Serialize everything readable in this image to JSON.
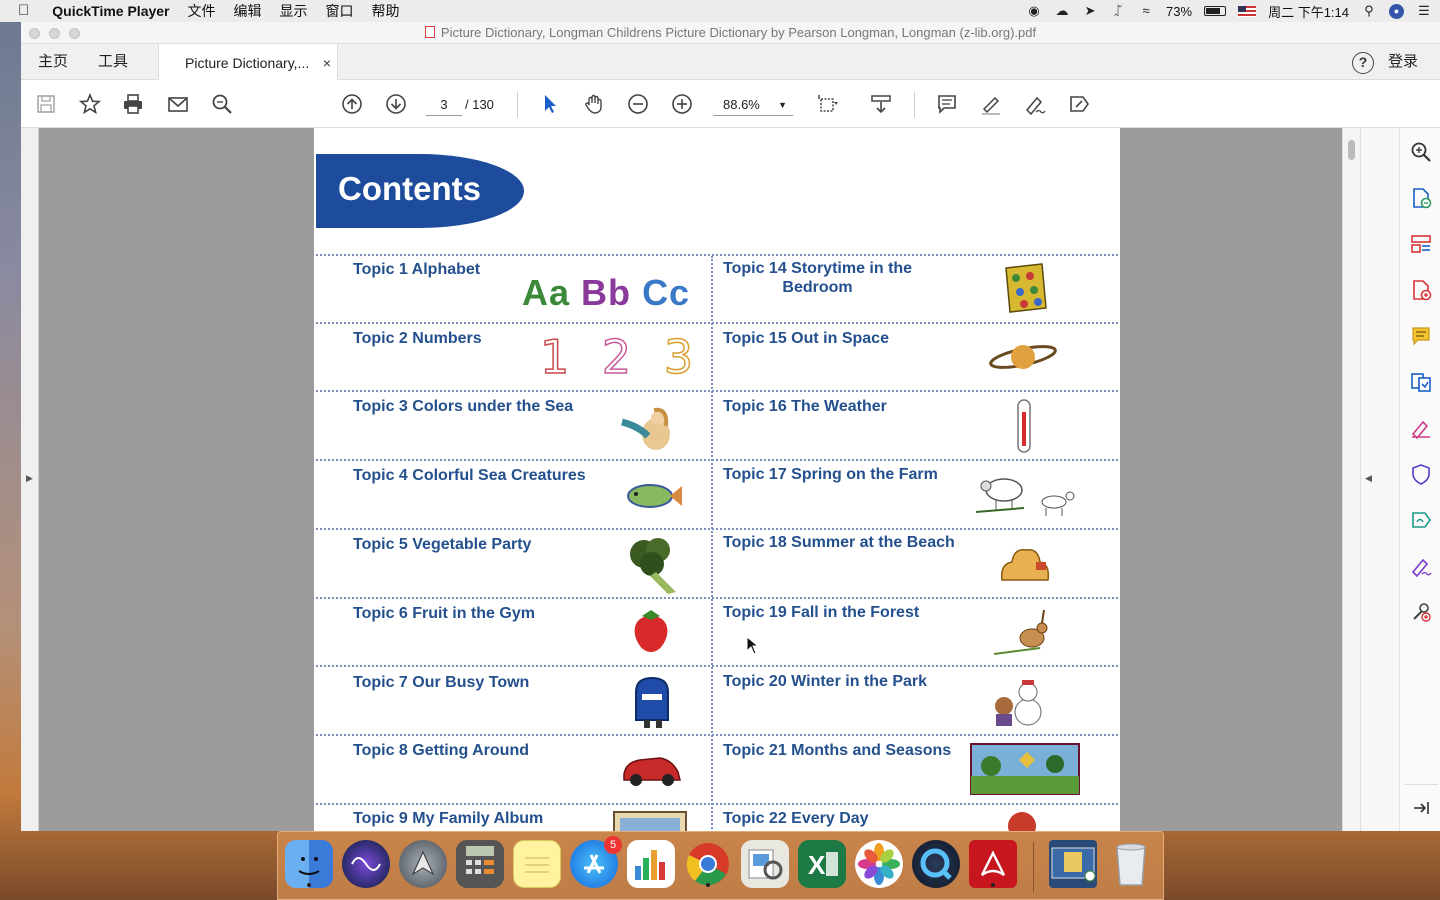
{
  "menubar": {
    "app_name": "QuickTime Player",
    "menus": [
      "文件",
      "编辑",
      "显示",
      "窗口",
      "帮助"
    ],
    "battery": "73%",
    "datetime": "周二 下午1:14"
  },
  "window": {
    "title": "Picture Dictionary, Longman Childrens Picture Dictionary by Pearson Longman, Longman (z-lib.org).pdf",
    "tabs": {
      "home": "主页",
      "tools": "工具",
      "doc": "Picture Dictionary,...",
      "close": "×"
    },
    "help": "?",
    "login": "登录"
  },
  "toolbar": {
    "page_current": "3",
    "page_total": "/ 130",
    "zoom": "88.6%"
  },
  "page": {
    "banner": "Contents",
    "left_topics": [
      "Topic 1 Alphabet",
      "Topic 2 Numbers",
      "Topic 3 Colors under the Sea",
      "Topic 4 Colorful Sea Creatures",
      "Topic 5 Vegetable Party",
      "Topic 6 Fruit in the Gym",
      "Topic 7 Our Busy Town",
      "Topic 8 Getting Around",
      "Topic 9 My Family Album"
    ],
    "right_topics": [
      "Topic 14 Storytime in the",
      "Topic 15 Out in Space",
      "Topic 16 The Weather",
      "Topic 17 Spring on the Farm",
      "Topic 18 Summer at the Beach",
      "Topic 19 Fall in the Forest",
      "Topic 20 Winter in the Park",
      "Topic 21  Months and Seasons",
      "Topic 22 Every Day"
    ],
    "right_topic_14_line2": "Bedroom",
    "alphabet_art": {
      "a1": "Aa",
      "a2": "Bb",
      "a3": "Cc"
    },
    "numbers_art": {
      "n1": "1",
      "n2": "2",
      "n3": "3"
    }
  },
  "dock": {
    "apps": [
      "finder",
      "siri",
      "launchpad",
      "calculator",
      "notes",
      "app-store",
      "numbers",
      "chrome",
      "preview",
      "excel",
      "photos",
      "quicktime",
      "acrobat",
      "pdf-doc",
      "trash"
    ],
    "app_store_badge": "5"
  },
  "colors": {
    "topic_text": "#24508e",
    "banner": "#1e4c9c",
    "dotted_rule": "#7a8fbf"
  }
}
